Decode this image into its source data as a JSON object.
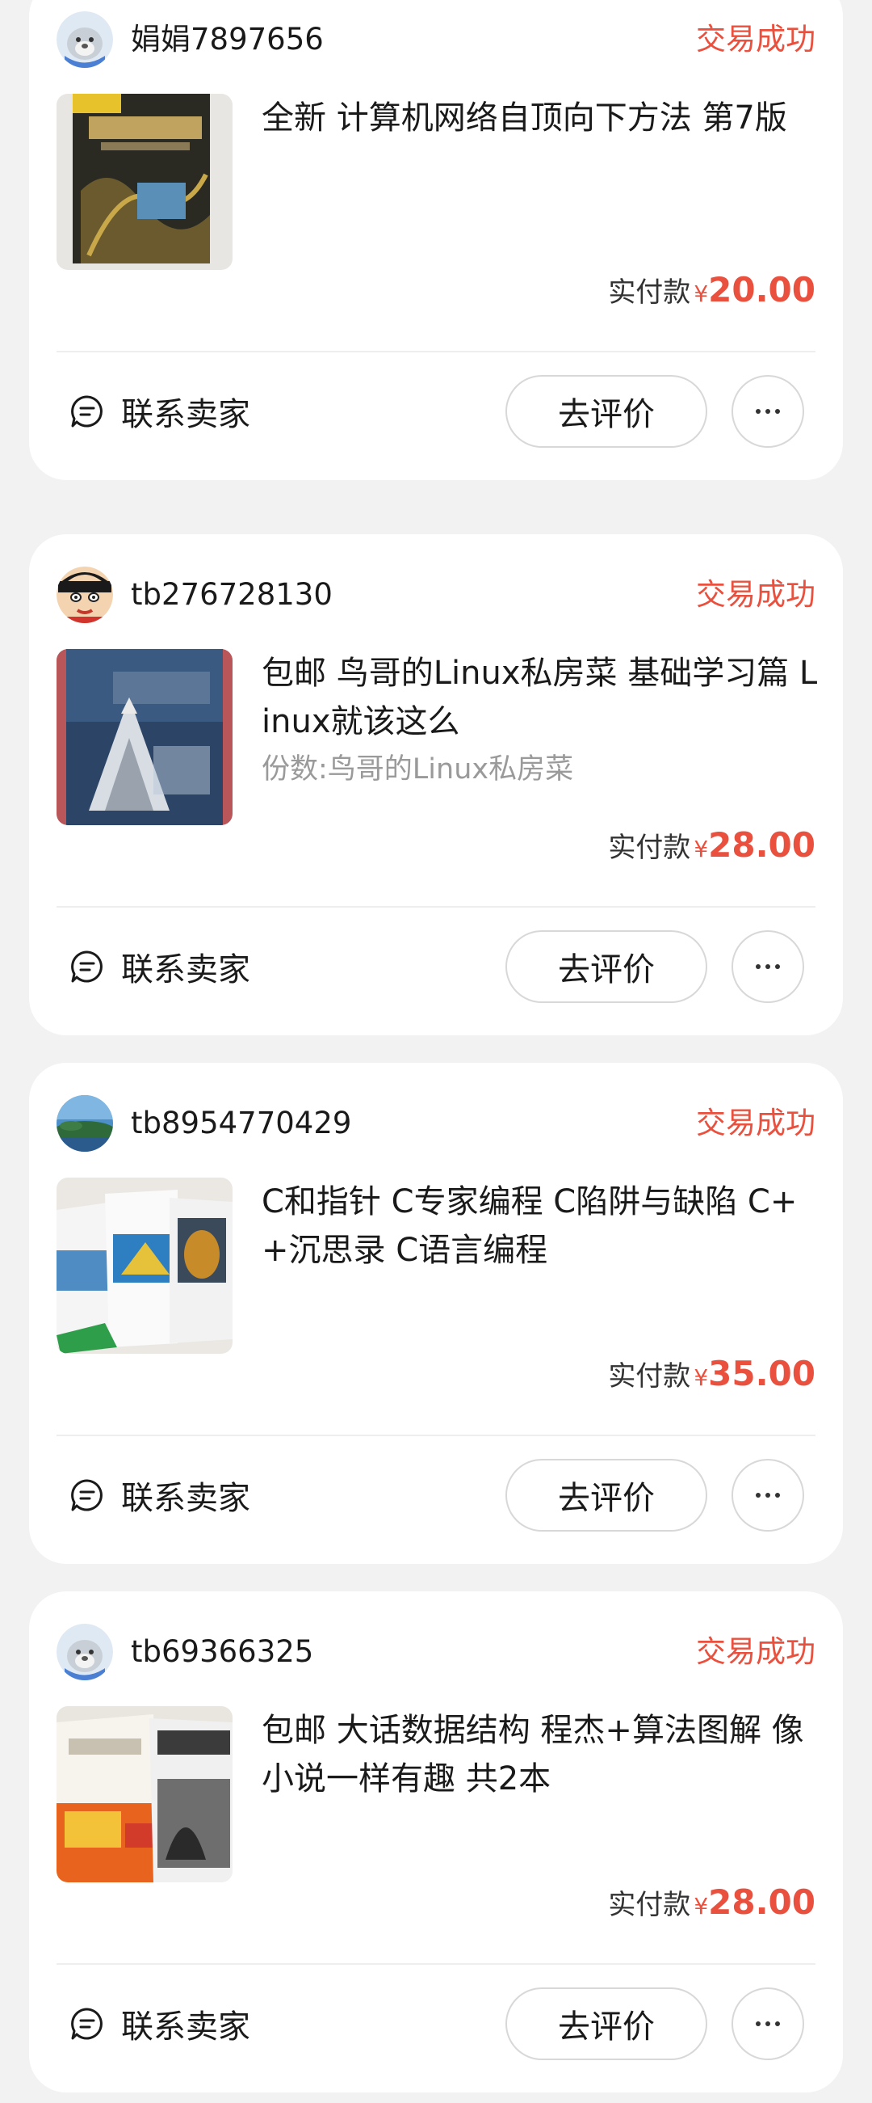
{
  "orders": [
    {
      "seller": "娟娟7897656",
      "avatar_icon": "seal-avatar-icon",
      "status": "交易成功",
      "title": "全新 计算机网络自顶向下方法  第7版",
      "subtitle": "",
      "pay_label": "实付款",
      "currency": "¥",
      "amount": "20.00",
      "contact_label": "联系卖家",
      "review_label": "去评价",
      "more_label": "···"
    },
    {
      "seller": "tb276728130",
      "avatar_icon": "cartoon-face-avatar-icon",
      "status": "交易成功",
      "title": "包邮 鸟哥的Linux私房菜 基础学习篇 Linux就该这么",
      "subtitle": "份数:鸟哥的Linux私房菜",
      "pay_label": "实付款",
      "currency": "¥",
      "amount": "28.00",
      "contact_label": "联系卖家",
      "review_label": "去评价",
      "more_label": "···"
    },
    {
      "seller": "tb8954770429",
      "avatar_icon": "landscape-avatar-icon",
      "status": "交易成功",
      "title": "C和指针 C专家编程 C陷阱与缺陷 C++沉思录 C语言编程",
      "subtitle": "",
      "pay_label": "实付款",
      "currency": "¥",
      "amount": "35.00",
      "contact_label": "联系卖家",
      "review_label": "去评价",
      "more_label": "···"
    },
    {
      "seller": "tb69366325",
      "avatar_icon": "seal-avatar-icon",
      "status": "交易成功",
      "title": "包邮 大话数据结构  程杰+算法图解 像小说一样有趣 共2本",
      "subtitle": "",
      "pay_label": "实付款",
      "currency": "¥",
      "amount": "28.00",
      "contact_label": "联系卖家",
      "review_label": "去评价",
      "more_label": "···"
    }
  ],
  "colors": {
    "accent": "#e9503e",
    "background": "#f2f2f2",
    "card": "#ffffff",
    "subtext": "#9a9a9a"
  }
}
